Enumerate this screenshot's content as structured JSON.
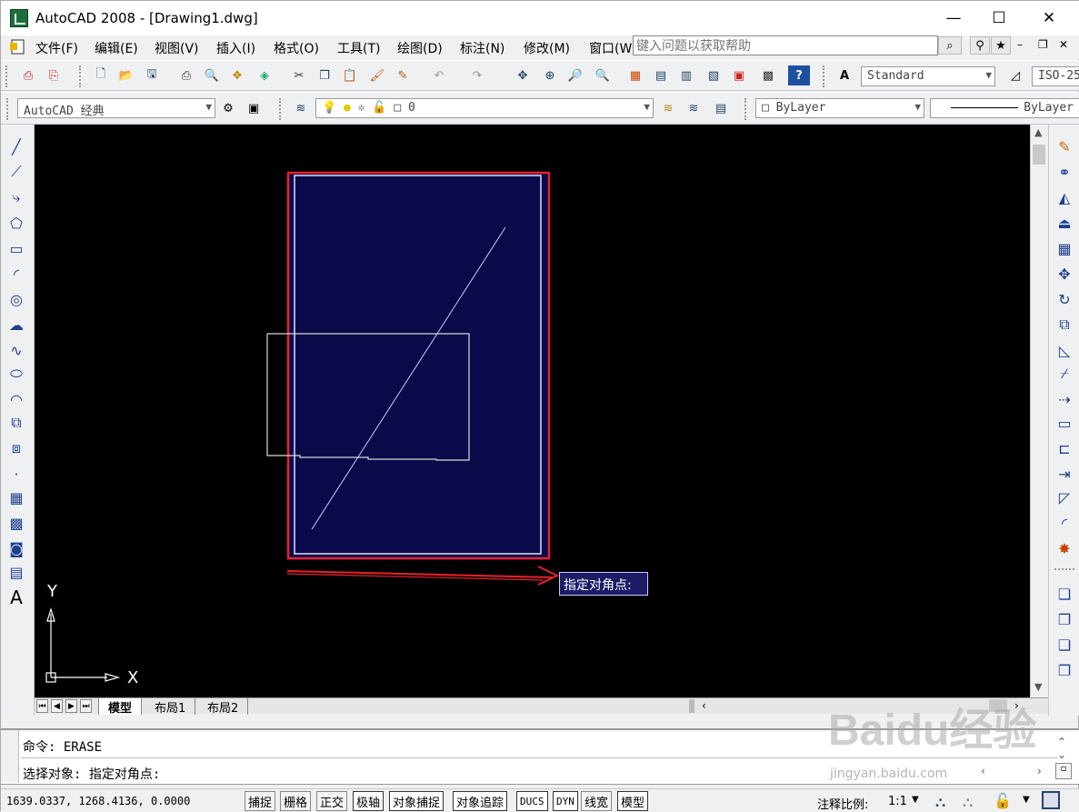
{
  "window": {
    "title": "AutoCAD 2008 - [Drawing1.dwg]",
    "minimize": "—",
    "maximize": "☐",
    "close": "✕"
  },
  "menu": [
    "文件(F)",
    "编辑(E)",
    "视图(V)",
    "插入(I)",
    "格式(O)",
    "工具(T)",
    "绘图(D)",
    "标注(N)",
    "修改(M)",
    "窗口(W)"
  ],
  "help": {
    "placeholder": "键入问题以获取帮助"
  },
  "toolbar": {
    "text_style": "Standard",
    "dim_style": "ISO-25",
    "workspace": "AutoCAD 经典",
    "layer": "0",
    "color": "ByLayer",
    "linetype": "ByLayer"
  },
  "canvas": {
    "tooltip": "指定对角点:",
    "ucs_y": "Y",
    "ucs_x": "X",
    "colors": {
      "background": "#000000",
      "selection_fill": "#0a0a4a",
      "annotation_red": "#e8202a",
      "line": "#c8c8ff"
    }
  },
  "tabs": [
    "模型",
    "布局1",
    "布局2"
  ],
  "command": {
    "line1": "命令:  ERASE",
    "line2": "选择对象: 指定对角点:"
  },
  "status": {
    "coords": "1639.0337,  1268.4136,  0.0000",
    "buttons": [
      "捕捉",
      "栅格",
      "正交",
      "极轴",
      "对象捕捉",
      "对象追踪",
      "DUCS",
      "DYN",
      "线宽",
      "模型"
    ],
    "annotation_scale_label": "注释比例:",
    "annotation_scale": "1:1"
  },
  "watermark": {
    "text": "Baidu经验",
    "url": "jingyan.baidu.com"
  }
}
